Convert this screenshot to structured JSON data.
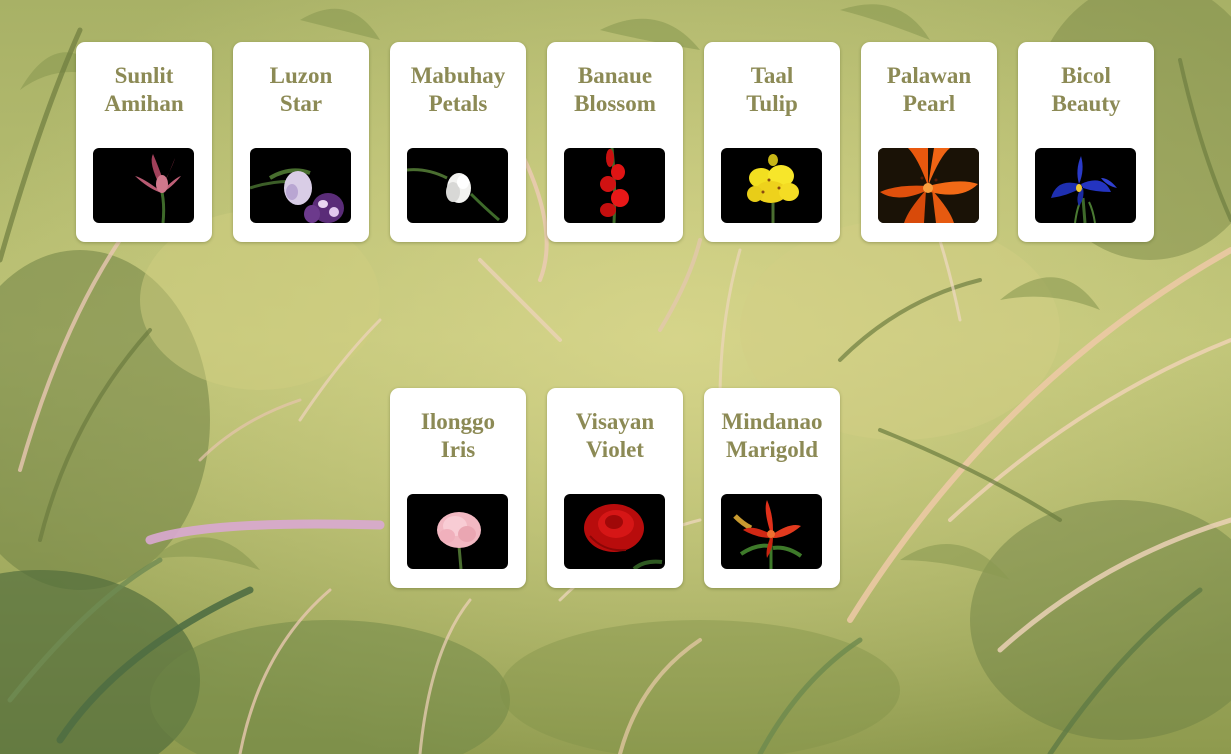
{
  "cards": [
    {
      "line1": "Sunlit",
      "line2": "Amihan",
      "icon": "pink-lily-icon"
    },
    {
      "line1": "Luzon",
      "line2": "Star",
      "icon": "purple-orchid-icon"
    },
    {
      "line1": "Mabuhay",
      "line2": "Petals",
      "icon": "white-orchid-icon"
    },
    {
      "line1": "Banaue",
      "line2": "Blossom",
      "icon": "red-gladiolus-icon"
    },
    {
      "line1": "Taal",
      "line2": "Tulip",
      "icon": "yellow-lily-icon"
    },
    {
      "line1": "Palawan",
      "line2": "Pearl",
      "icon": "orange-lily-icon"
    },
    {
      "line1": "Bicol",
      "line2": "Beauty",
      "icon": "blue-iris-icon"
    },
    {
      "line1": "Ilonggo",
      "line2": "Iris",
      "icon": "pink-carnation-icon"
    },
    {
      "line1": "Visayan",
      "line2": "Violet",
      "icon": "red-rose-icon"
    },
    {
      "line1": "Mindanao",
      "line2": "Marigold",
      "icon": "red-lily-icon"
    }
  ],
  "colors": {
    "title": "#8c8a55",
    "card": "#ffffff",
    "thumb_bg": "#000000"
  }
}
